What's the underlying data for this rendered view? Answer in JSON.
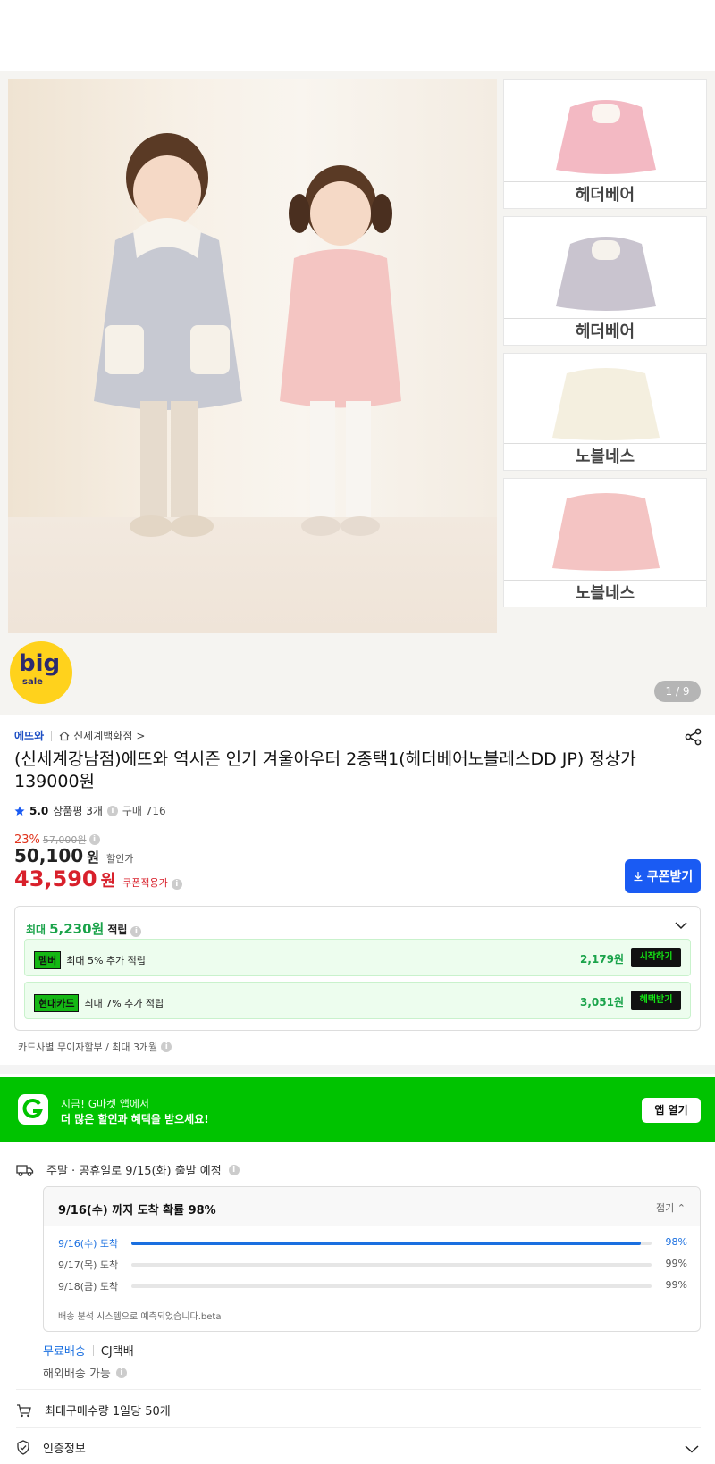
{
  "gallery": {
    "thumbnails": [
      {
        "label": "헤더베어",
        "color": "#f3b9c3"
      },
      {
        "label": "헤더베어",
        "color": "#c9c4cf"
      },
      {
        "label": "노블네스",
        "color": "#f4efdf"
      },
      {
        "label": "노블네스",
        "color": "#f4c4c3"
      }
    ],
    "counter": "1 / 9",
    "badge": {
      "big": "big",
      "sale": "sale"
    }
  },
  "product": {
    "brand": "에뜨와",
    "store": "신세계백화점",
    "store_chevron": ">",
    "title": "(신세계강남점)에뜨와 역시즌 인기 겨울아우터 2종택1(헤더베어노블레스DD JP) 정상가 139000원",
    "rating_score": "5.0",
    "reviews": "상품평 3개",
    "purchases": "구매 716",
    "discount_rate": "23%",
    "original_price": "57,000원",
    "sale_price": "50,100",
    "sale_won": "원",
    "sale_tag": "할인가",
    "coupon_price": "43,590",
    "coupon_won": "원",
    "coupon_tag": "쿠폰적용가",
    "coupon_button": "쿠폰받기"
  },
  "points": {
    "prefix": "최대",
    "amount": "5,230원",
    "suffix": "적립",
    "rows": [
      {
        "chip": "멤버",
        "text": "최대 5% 추가 적립",
        "value": "2,179원",
        "button": "시작하기"
      },
      {
        "chip": "현대카드",
        "text": "최대 7% 추가 적립",
        "value": "3,051원",
        "button": "혜택받기"
      }
    ],
    "installment": "카드사별 무이자할부 / 최대 3개월"
  },
  "app_banner": {
    "line1": "지금! G마켓 앱에서",
    "line2": "더 많은 할인과 혜택을 받으세요!",
    "button": "앱 열기"
  },
  "shipping": {
    "header": "주말 · 공휴일로 9/15(화) 출발 예정",
    "eta_title": "9/16(수) 까지 도착 확률 98%",
    "fold": "접기",
    "rows": [
      {
        "date": "9/16(수) 도착",
        "percent": "98%",
        "fraction": 0.98
      },
      {
        "date": "9/17(목) 도착",
        "percent": "99%",
        "fraction": 0
      },
      {
        "date": "9/18(금) 도착",
        "percent": "99%",
        "fraction": 0
      }
    ],
    "note": "배송 분석 시스템으로 예측되었습니다.beta",
    "free": "무료배송",
    "carrier": "CJ택배",
    "overseas": "해외배송 가능"
  },
  "limits": {
    "max_purchase": "최대구매수량 1일당 50개",
    "certification": "인증정보"
  },
  "colors": {
    "accent_blue": "#1a5bf3",
    "price_red": "#d8202b",
    "gmarket_green": "#00c300"
  }
}
